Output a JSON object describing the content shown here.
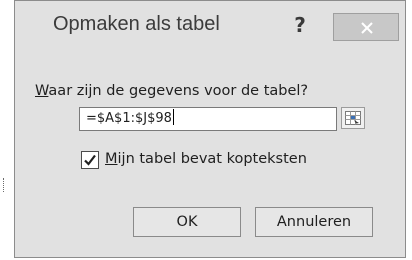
{
  "dialog": {
    "title": "Opmaken als tabel",
    "help_label": "?",
    "close_icon": "close-icon"
  },
  "prompt": {
    "mnemonic": "W",
    "rest": "aar zijn de gegevens voor de tabel?"
  },
  "range": {
    "value": "=$A$1:$J$98",
    "collapse_icon": "range-collapse-icon"
  },
  "headers_checkbox": {
    "checked": true,
    "mnemonic": "M",
    "rest": "ijn tabel bevat kopteksten"
  },
  "buttons": {
    "ok": "OK",
    "cancel": "Annuleren"
  },
  "colors": {
    "dialog_bg": "#e1e1e1",
    "close_bg": "#c8c8c8",
    "text": "#1f1f1f"
  }
}
